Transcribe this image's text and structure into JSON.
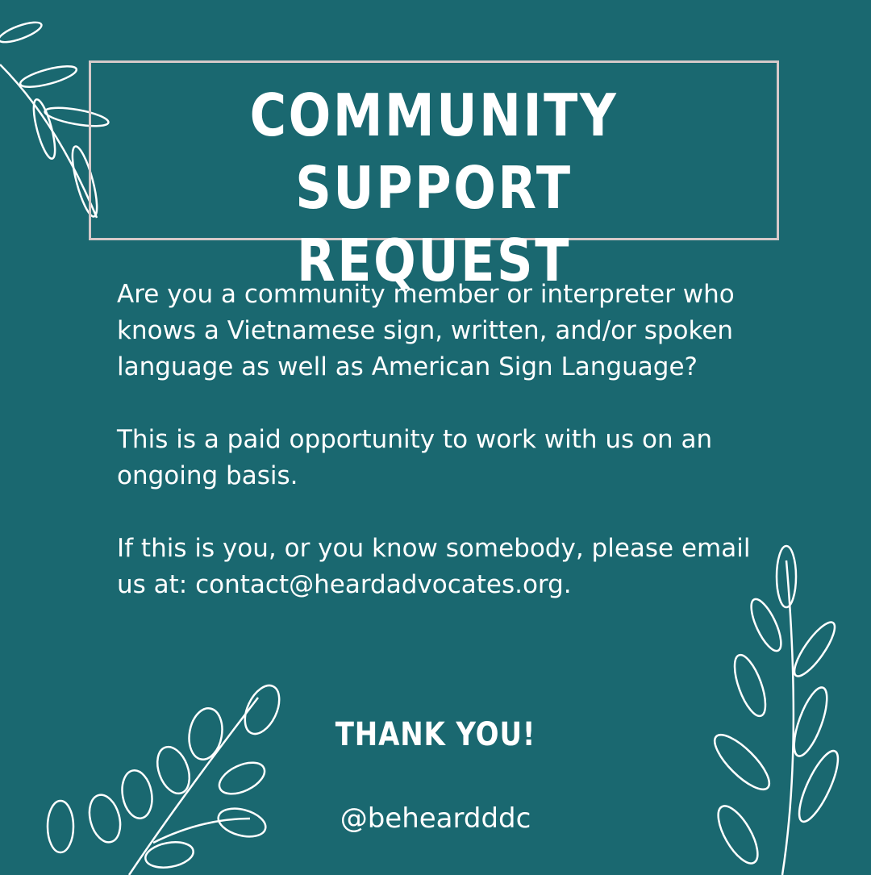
{
  "colors": {
    "background": "#1a6870",
    "frame": "#d6c9c9",
    "text": "#ffffff"
  },
  "title": {
    "line1": "COMMUNITY SUPPORT",
    "line2": "REQUEST"
  },
  "body": {
    "paragraph1": "Are you a community member or interpreter who knows a Vietnamese sign, written, and/or spoken language as well as American Sign Language?",
    "paragraph2": "This is a paid opportunity to work with us on an ongoing basis.",
    "paragraph3": "If this is you, or you know somebody, please email us at: contact@heardadvocates.org."
  },
  "thanks": "THANK YOU!",
  "handle": "@beheardddc"
}
